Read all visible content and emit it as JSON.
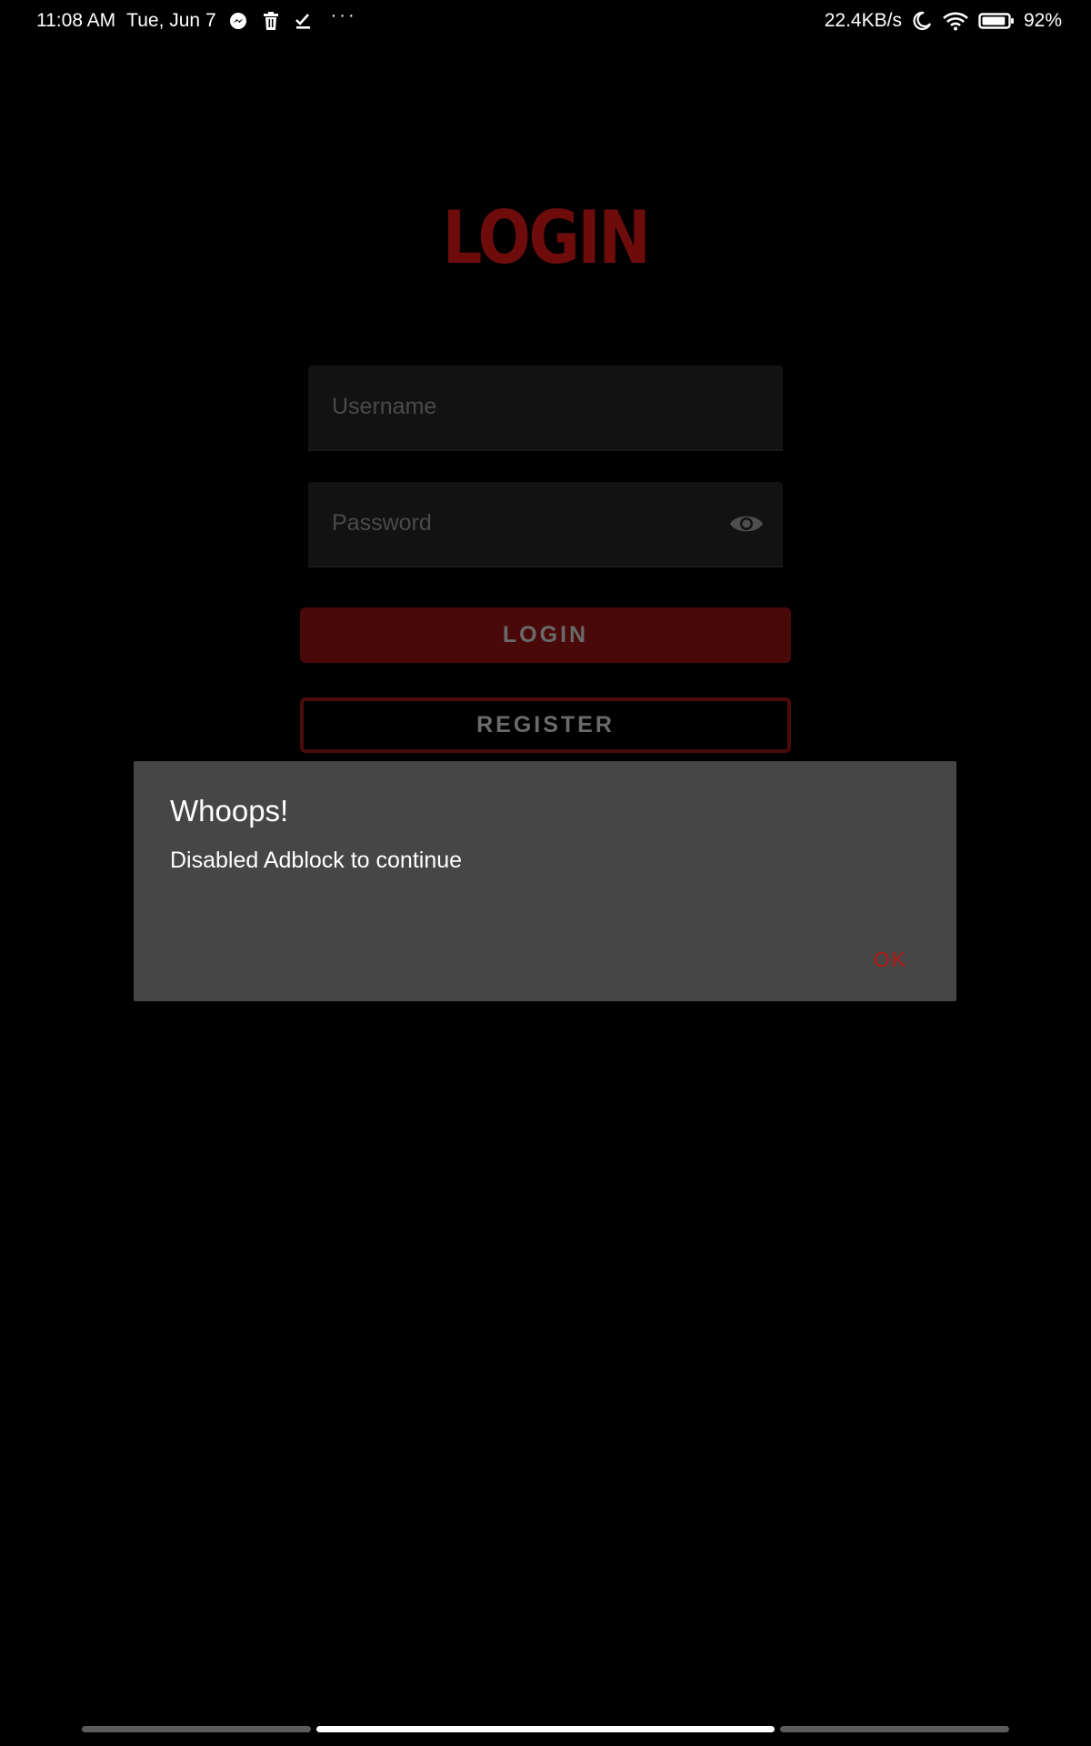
{
  "statusbar": {
    "time": "11:08 AM",
    "date": "Tue, Jun 7",
    "notification_icons": [
      "messenger-icon",
      "trash-icon",
      "task-check-icon"
    ],
    "more_indicator": "···",
    "network_speed": "22.4KB/s",
    "battery_percent": "92%",
    "battery_level": 0.92
  },
  "login": {
    "title": "LOGIN",
    "username_placeholder": "Username",
    "password_placeholder": "Password",
    "login_button": "LOGIN",
    "register_button": "REGISTER"
  },
  "dialog": {
    "title": "Whoops!",
    "message": "Disabled Adblock to continue",
    "ok_button": "OK"
  },
  "colors": {
    "background": "#000000",
    "brand_red": "#6e0c0c",
    "dialog_bg": "#464646",
    "ok_accent": "#b4160f"
  }
}
